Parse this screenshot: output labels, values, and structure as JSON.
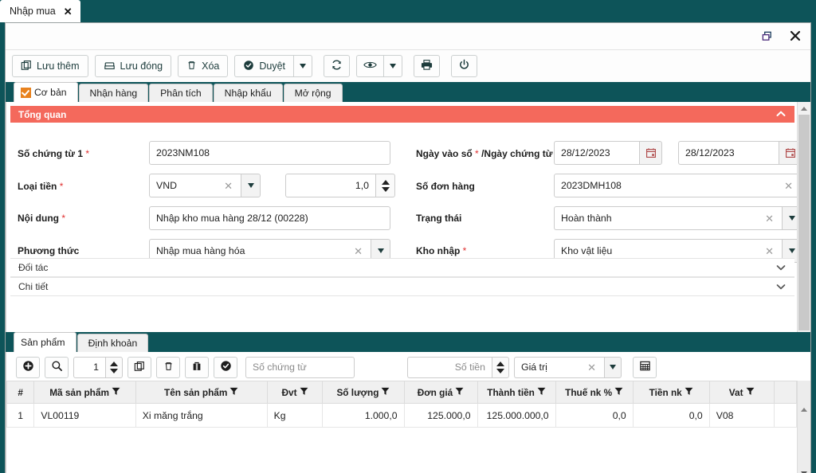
{
  "window": {
    "tab_title": "Nhập mua",
    "tab_close": "✕",
    "restore_icon": "restore-window-icon",
    "close_icon": "close-window-icon"
  },
  "toolbar": {
    "buttons": [
      {
        "label": "Lưu thêm",
        "icon": "copy-icon"
      },
      {
        "label": "Lưu đóng",
        "icon": "save-close-icon"
      },
      {
        "label": "Xóa",
        "icon": "trash-icon"
      },
      {
        "label": "Duyệt",
        "icon": "check-circle-icon"
      }
    ],
    "refresh_icon": "refresh-icon",
    "eye_icon": "eye-icon",
    "print_icon": "print-icon",
    "power_icon": "power-icon"
  },
  "main_tabs": [
    {
      "label": "Cơ bản",
      "active": true,
      "checked": true
    },
    {
      "label": "Nhận hàng",
      "active": false,
      "checked": false
    },
    {
      "label": "Phân tích",
      "active": false,
      "checked": false
    },
    {
      "label": "Nhập khẩu",
      "active": false,
      "checked": false
    },
    {
      "label": "Mở rộng",
      "active": false,
      "checked": false
    }
  ],
  "form": {
    "section_title": "Tổng quan",
    "section_chevron": "chevron-up-icon",
    "fields": {
      "so_chung_tu": {
        "label": "Số chứng từ 1",
        "required": "*",
        "value": "2023NM108"
      },
      "ngay_vao_so": {
        "label": "Ngày vào sổ",
        "required": "*",
        "label2": "/Ngày chứng từ",
        "required2": "*",
        "value": "28/12/2023",
        "value2": "28/12/2023",
        "icon": "calendar-icon"
      },
      "loai_tien": {
        "label": "Loại tiền",
        "required": "*",
        "value": "VND"
      },
      "ty_gia": {
        "value": "1,0"
      },
      "so_don_hang": {
        "label": "Số đơn hàng",
        "value": "2023DMH108"
      },
      "noi_dung": {
        "label": "Nội dung",
        "required": "*",
        "value": "Nhập kho mua hàng 28/12 (00228)"
      },
      "trang_thai": {
        "label": "Trạng thái",
        "value": "Hoàn thành"
      },
      "phuong_thuc": {
        "label": "Phương thức",
        "value": "Nhập mua hàng hóa"
      },
      "kho_nhap": {
        "label": "Kho nhập",
        "required": "*",
        "value": "Kho vật liệu"
      }
    },
    "collapsed_sections": [
      {
        "label": "Đối tác",
        "chevron": "chevron-down-icon"
      },
      {
        "label": "Chi tiết",
        "chevron": "chevron-down-icon"
      }
    ]
  },
  "grid": {
    "tabs": [
      {
        "label": "Sản phẩm",
        "active": true
      },
      {
        "label": "Định khoản",
        "active": false
      }
    ],
    "toolbar": {
      "add_icon": "add-circle-icon",
      "search_icon": "search-icon",
      "row_count": "1",
      "copy_icon": "copy-rows-icon",
      "delete_icon": "trash-icon",
      "briefcase_icon": "briefcase-icon",
      "approve_icon": "check-circle-icon",
      "so_chung_tu_placeholder": "Số chứng từ",
      "so_tien_placeholder": "Số tiền",
      "gia_tri_value": "Giá trị",
      "calc_icon": "calculator-icon"
    },
    "columns": [
      {
        "label": "#",
        "filter": false,
        "align": "center"
      },
      {
        "label": "Mã sản phẩm",
        "filter": true,
        "align": "left"
      },
      {
        "label": "Tên sản phẩm",
        "filter": true,
        "align": "left"
      },
      {
        "label": "Đvt",
        "filter": true,
        "align": "left"
      },
      {
        "label": "Số lượng",
        "filter": true,
        "align": "right"
      },
      {
        "label": "Đơn giá",
        "filter": true,
        "align": "right"
      },
      {
        "label": "Thành tiền",
        "filter": true,
        "align": "right"
      },
      {
        "label": "Thuế nk %",
        "filter": true,
        "align": "right"
      },
      {
        "label": "Tiền nk",
        "filter": true,
        "align": "right"
      },
      {
        "label": "Vat",
        "filter": true,
        "align": "left"
      }
    ],
    "rows": [
      {
        "index": "1",
        "ma_san_pham": "VL00119",
        "ten_san_pham": "Xi măng trắng",
        "dvt": "Kg",
        "so_luong": "1.000,0",
        "don_gia": "125.000,0",
        "thanh_tien": "125.000.000,0",
        "thue_nk": "0,0",
        "tien_nk": "0,0",
        "vat": "V08"
      }
    ]
  },
  "colors": {
    "teal": "#0d5459",
    "section_red": "#f4695c",
    "tick_orange": "#e8821e",
    "required_red": "#e03131"
  }
}
